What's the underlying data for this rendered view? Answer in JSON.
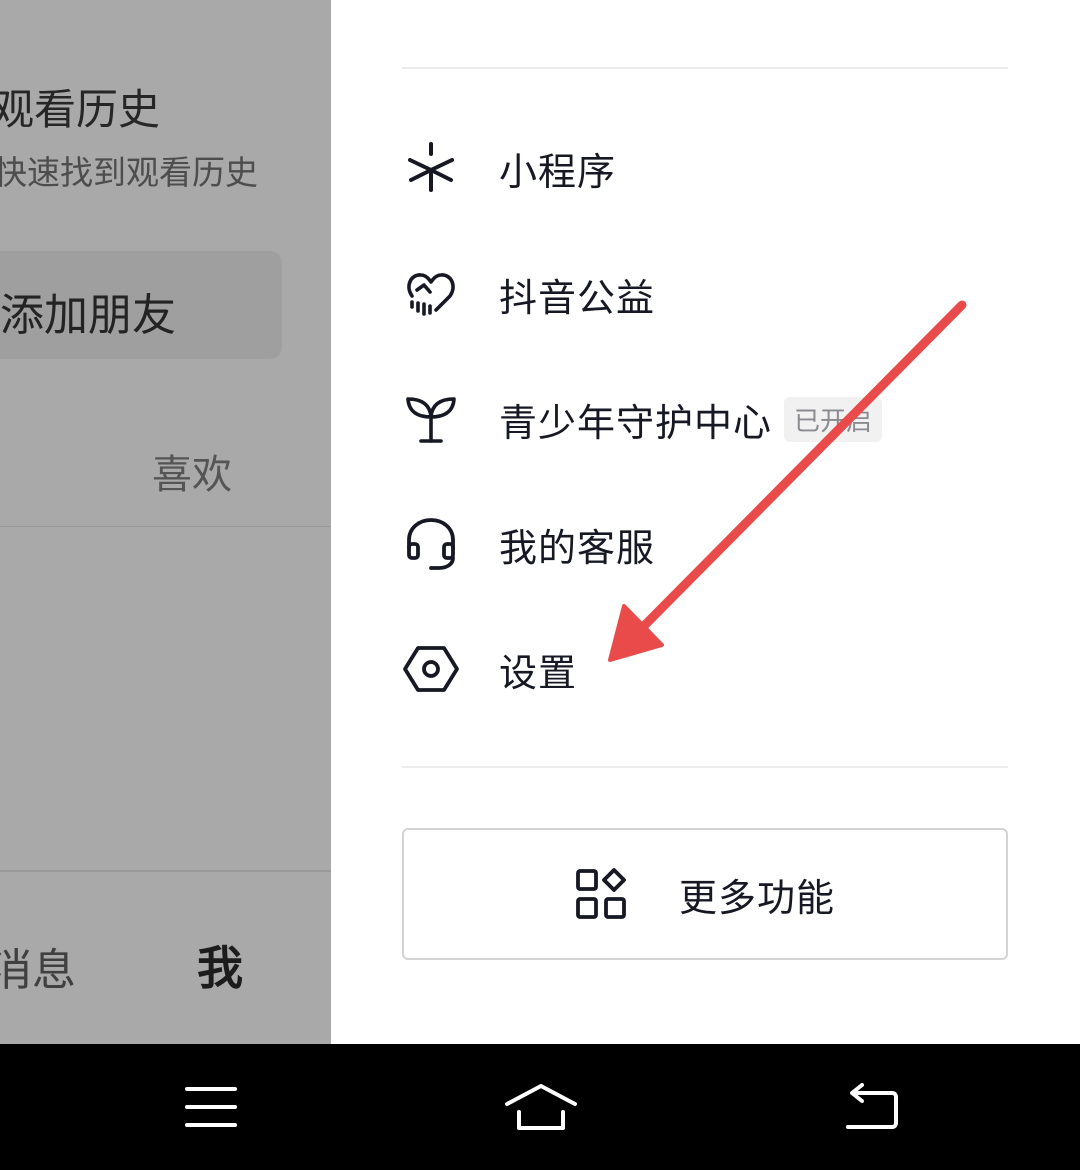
{
  "background_page": {
    "history_title": "观看历史",
    "history_subtitle": "快速找到观看历史",
    "add_friend_label": "添加朋友",
    "like_tab_label": "喜欢",
    "nav_message_label": "消息",
    "nav_me_label": "我"
  },
  "drawer": {
    "menu_items": [
      {
        "label": "小程序",
        "icon": "mini-program-icon"
      },
      {
        "label": "抖音公益",
        "icon": "charity-heart-icon"
      },
      {
        "label": "青少年守护中心",
        "icon": "sprout-icon",
        "badge": "已开启"
      },
      {
        "label": "我的客服",
        "icon": "headset-icon"
      },
      {
        "label": "设置",
        "icon": "settings-hexagon-icon"
      }
    ],
    "more_button_label": "更多功能",
    "more_button_icon": "apps-grid-icon"
  },
  "annotation": {
    "arrow_color": "#e94b4b",
    "target": "设置"
  },
  "system_nav": {
    "buttons": [
      "menu-icon",
      "home-icon",
      "back-icon"
    ]
  },
  "colors": {
    "text_primary": "#161823",
    "overlay_gray": "#a9a9a9",
    "badge_bg": "#f1f1f2",
    "badge_text": "#8a8b91"
  }
}
